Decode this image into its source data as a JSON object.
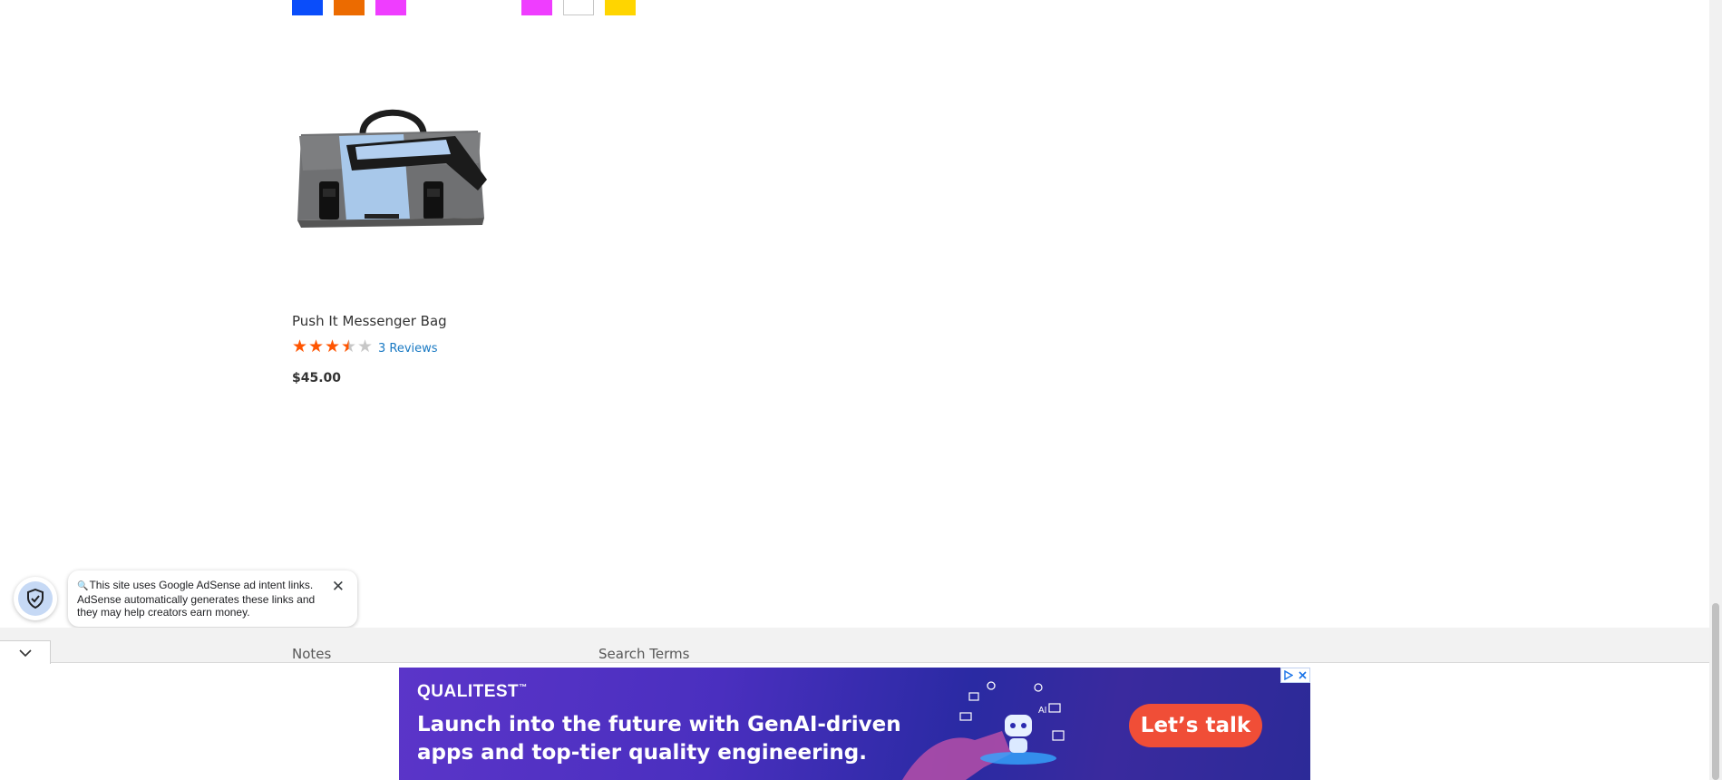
{
  "swatches": {
    "group1": [
      {
        "name": "Blue",
        "color": "#0a4dfa"
      },
      {
        "name": "Orange",
        "color": "#ec6b00"
      },
      {
        "name": "Purple",
        "color": "#ef3dff"
      }
    ],
    "group2": [
      {
        "name": "Purple",
        "color": "#ef3dff"
      },
      {
        "name": "White",
        "color": "#ffffff"
      },
      {
        "name": "Yellow",
        "color": "#ffd500"
      }
    ]
  },
  "product": {
    "image_icon": "messenger-bag-image",
    "name": "Push It Messenger Bag",
    "rating_fraction": 0.7,
    "star_color": "#ff5501",
    "star_empty_color": "#c7c7c7",
    "reviews_label": "3 Reviews",
    "price": "$45.00"
  },
  "adsense_notice": {
    "icon": "shield-check-icon",
    "text": "This site uses Google AdSense ad intent links. AdSense automatically generates these links and they may help creators earn money.",
    "close_icon": "close-icon"
  },
  "footer": {
    "toggle_icon": "chevron-down-icon",
    "links": [
      "Notes",
      "Search Terms"
    ]
  },
  "ad": {
    "brand": "QUALITEST",
    "brand_mark": "™",
    "headline": "Launch into the future with GenAI-driven apps and top-tier quality engineering.",
    "cta": "Let’s talk",
    "cta_color": "#f04e37",
    "art_label": "AI"
  }
}
